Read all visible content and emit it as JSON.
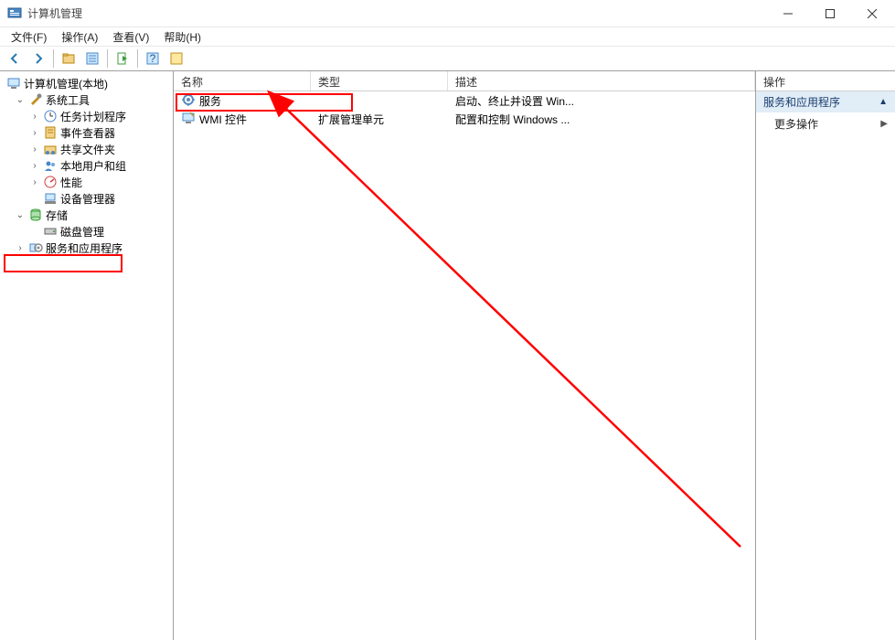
{
  "title": "计算机管理",
  "menu": {
    "file": "文件(F)",
    "action": "操作(A)",
    "view": "查看(V)",
    "help": "帮助(H)"
  },
  "tree": {
    "root": "计算机管理(本地)",
    "system_tools": "系统工具",
    "task_scheduler": "任务计划程序",
    "event_viewer": "事件查看器",
    "shared_folders": "共享文件夹",
    "local_users": "本地用户和组",
    "performance": "性能",
    "device_manager": "设备管理器",
    "storage": "存储",
    "disk_management": "磁盘管理",
    "services_apps": "服务和应用程序"
  },
  "list": {
    "headers": {
      "name": "名称",
      "type": "类型",
      "desc": "描述"
    },
    "rows": [
      {
        "name": "服务",
        "type": "",
        "desc": "启动、终止并设置 Win..."
      },
      {
        "name": "WMI 控件",
        "type": "扩展管理单元",
        "desc": "配置和控制 Windows ..."
      }
    ]
  },
  "actions": {
    "header": "操作",
    "group": "服务和应用程序",
    "more": "更多操作"
  },
  "twisty": {
    "expanded": "⌄",
    "collapsed": "›"
  }
}
